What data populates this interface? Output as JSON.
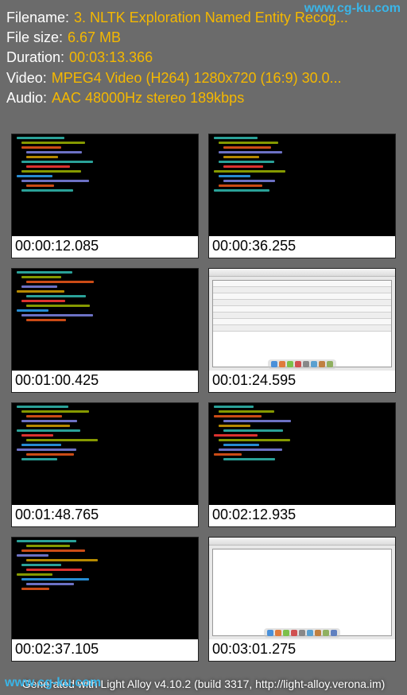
{
  "watermark": "www.cg-ku.com",
  "header": {
    "filename_label": "Filename:",
    "filename_value": "3. NLTK Exploration Named Entity Recog...",
    "filesize_label": "File size:",
    "filesize_value": "6.67 MB",
    "duration_label": "Duration:",
    "duration_value": "00:03:13.366",
    "video_label": "Video:",
    "video_value": "MPEG4 Video (H264) 1280x720 (16:9) 30.0...",
    "audio_label": "Audio:",
    "audio_value": "AAC 48000Hz stereo 189kbps"
  },
  "thumbs": [
    {
      "time": "00:00:12.085",
      "kind": "code"
    },
    {
      "time": "00:00:36.255",
      "kind": "code"
    },
    {
      "time": "00:01:00.425",
      "kind": "code"
    },
    {
      "time": "00:01:24.595",
      "kind": "app"
    },
    {
      "time": "00:01:48.765",
      "kind": "code"
    },
    {
      "time": "00:02:12.935",
      "kind": "code"
    },
    {
      "time": "00:02:37.105",
      "kind": "code"
    },
    {
      "time": "00:03:01.275",
      "kind": "app-empty"
    }
  ],
  "footer": "Generated with Light Alloy v4.10.2 (build 3317, http://light-alloy.verona.im)"
}
